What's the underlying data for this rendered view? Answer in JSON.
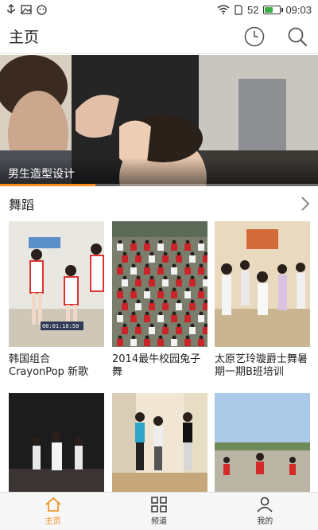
{
  "status_bar": {
    "battery_level": "52",
    "time": "09:03",
    "battery_fraction": 0.52
  },
  "app_bar": {
    "title": "主页",
    "icons": [
      "history-clock-icon",
      "search-icon"
    ]
  },
  "banner": {
    "caption": "男生造型设计",
    "progress_fraction": 0.3
  },
  "section": {
    "title": "舞蹈",
    "more_icon": "chevron-right-icon"
  },
  "videos": [
    {
      "title": "韩国组合CrayonPop 新歌",
      "timestamp": "00:01:16:50"
    },
    {
      "title": "2014最牛校园兔子舞"
    },
    {
      "title": "太原艺玲璇爵士舞暑期一期B班培训"
    },
    {
      "title": ""
    },
    {
      "title": ""
    },
    {
      "title": ""
    }
  ],
  "bottom_nav": {
    "items": [
      {
        "label": "主页",
        "icon": "home-icon",
        "active": true
      },
      {
        "label": "频道",
        "icon": "grid-icon",
        "active": false
      },
      {
        "label": "我的",
        "icon": "user-icon",
        "active": false
      }
    ]
  },
  "colors": {
    "accent": "#f08a17",
    "progress": "#ff8c1a",
    "battery": "#3cb043"
  }
}
